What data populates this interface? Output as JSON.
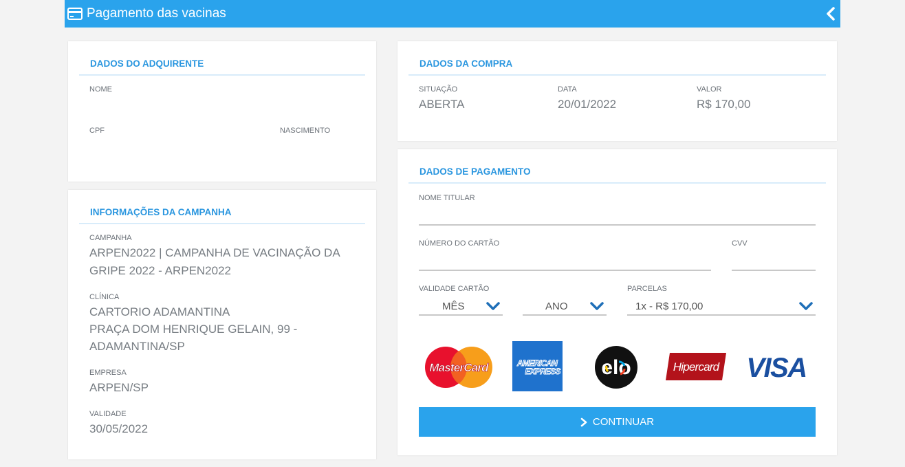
{
  "header": {
    "title": "Pagamento das vacinas"
  },
  "adquirente": {
    "title": "DADOS DO ADQUIRENTE",
    "nome_label": "NOME",
    "cpf_label": "CPF",
    "nascimento_label": "NASCIMENTO"
  },
  "campanha": {
    "title": "INFORMAÇÕES DA CAMPANHA",
    "campanha_label": "CAMPANHA",
    "campanha_line1": "ARPEN2022 | CAMPANHA DE VACINAÇÃO DA",
    "campanha_line2": "GRIPE 2022 - ARPEN2022",
    "clinica_label": "CLÍNICA",
    "clinica_line1": "CARTORIO ADAMANTINA",
    "clinica_line2": "PRAÇA DOM HENRIQUE GELAIN, 99 -",
    "clinica_line3": "ADAMANTINA/SP",
    "empresa_label": "EMPRESA",
    "empresa_value": "ARPEN/SP",
    "validade_label": "VALIDADE",
    "validade_value": "30/05/2022"
  },
  "compra": {
    "title": "DADOS DA COMPRA",
    "situacao_label": "SITUAÇÃO",
    "situacao_value": "ABERTA",
    "data_label": "DATA",
    "data_value": "20/01/2022",
    "valor_label": "VALOR",
    "valor_value": "R$ 170,00"
  },
  "pagamento": {
    "title": "DADOS DE PAGAMENTO",
    "nome_titular_label": "NOME TITULAR",
    "numero_cartao_label": "NÚMERO DO CARTÃO",
    "cvv_label": "CVV",
    "validade_label": "VALIDADE CARTÃO",
    "mes_value": "MÊS",
    "ano_value": "ANO",
    "parcelas_label": "PARCELAS",
    "parcelas_value": "1x - R$ 170,00",
    "brands": {
      "mastercard": "MasterCard",
      "amex_line1": "AMERICAN",
      "amex_line2": "EXPRESS",
      "elo": "elo",
      "hipercard": "Hipercard",
      "visa": "VISA"
    },
    "continue_label": "CONTINUAR"
  },
  "colors": {
    "primary": "#2aa3ec",
    "title": "#2a96df",
    "chevron": "#1f6fb8"
  }
}
